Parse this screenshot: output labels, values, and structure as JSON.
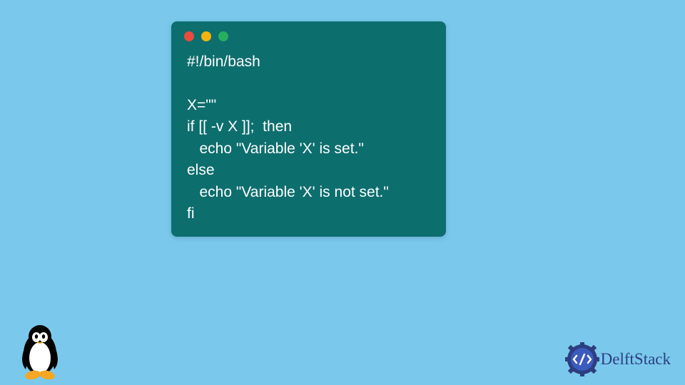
{
  "code": {
    "lines": [
      "#!/bin/bash",
      "",
      "X=\"\"",
      "if [[ -v X ]];  then",
      "   echo \"Variable 'X' is set.\"",
      "else",
      "   echo \"Variable 'X' is not set.\"",
      "fi"
    ]
  },
  "logo": {
    "text": "DelftStack"
  },
  "colors": {
    "background": "#7ac9ed",
    "window": "#0d6e6e",
    "codeText": "#ffffff",
    "btnRed": "#e74c3c",
    "btnYellow": "#f1b40f",
    "btnGreen": "#27ae60",
    "logoText": "#2d3e7f"
  }
}
